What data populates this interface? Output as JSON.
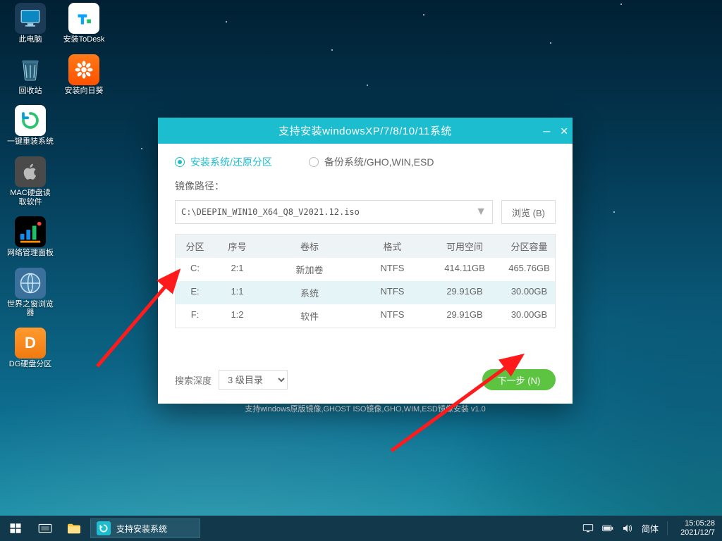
{
  "desktop": {
    "this_pc": "此电脑",
    "recycle_bin": "回收站",
    "one_key_reinstall": "一键重装系统",
    "mac_disk_reader": "MAC硬盘读\n取软件",
    "network_panel": "网络管理面板",
    "world_browser": "世界之窗浏览\n器",
    "dg_partition": "DG硬盘分区",
    "install_todesk": "安装ToDesk",
    "install_sunflower": "安装向日葵"
  },
  "installer": {
    "title": "支持安装windowsXP/7/8/10/11系统",
    "tab_install": "安装系统/还原分区",
    "tab_backup": "备份系统/GHO,WIN,ESD",
    "image_path_label": "镜像路径：",
    "image_path": "C:\\DEEPIN_WIN10_X64_Q8_V2021.12.iso",
    "browse_label": "浏览 (B)",
    "table": {
      "headers": {
        "part": "分区",
        "seq": "序号",
        "label": "卷标",
        "fmt": "格式",
        "free": "可用空间",
        "cap": "分区容量"
      },
      "rows": [
        {
          "part": "C:",
          "seq": "2:1",
          "label": "新加卷",
          "fmt": "NTFS",
          "free": "414.11GB",
          "cap": "465.76GB"
        },
        {
          "part": "E:",
          "seq": "1:1",
          "label": "系统",
          "fmt": "NTFS",
          "free": "29.91GB",
          "cap": "30.00GB"
        },
        {
          "part": "F:",
          "seq": "1:2",
          "label": "软件",
          "fmt": "NTFS",
          "free": "29.91GB",
          "cap": "30.00GB"
        }
      ]
    },
    "search_depth_label": "搜索深度",
    "search_depth_value": "3 级目录",
    "next_label": "下一步 (N)",
    "support_hint": "支持windows原版镜像,GHOST ISO镜像,GHO,WIM,ESD镜像安装     v1.0"
  },
  "taskbar": {
    "task_label": "支持安装系统",
    "ime": "简体",
    "time": "15:05:28",
    "date": "2021/12/7"
  }
}
